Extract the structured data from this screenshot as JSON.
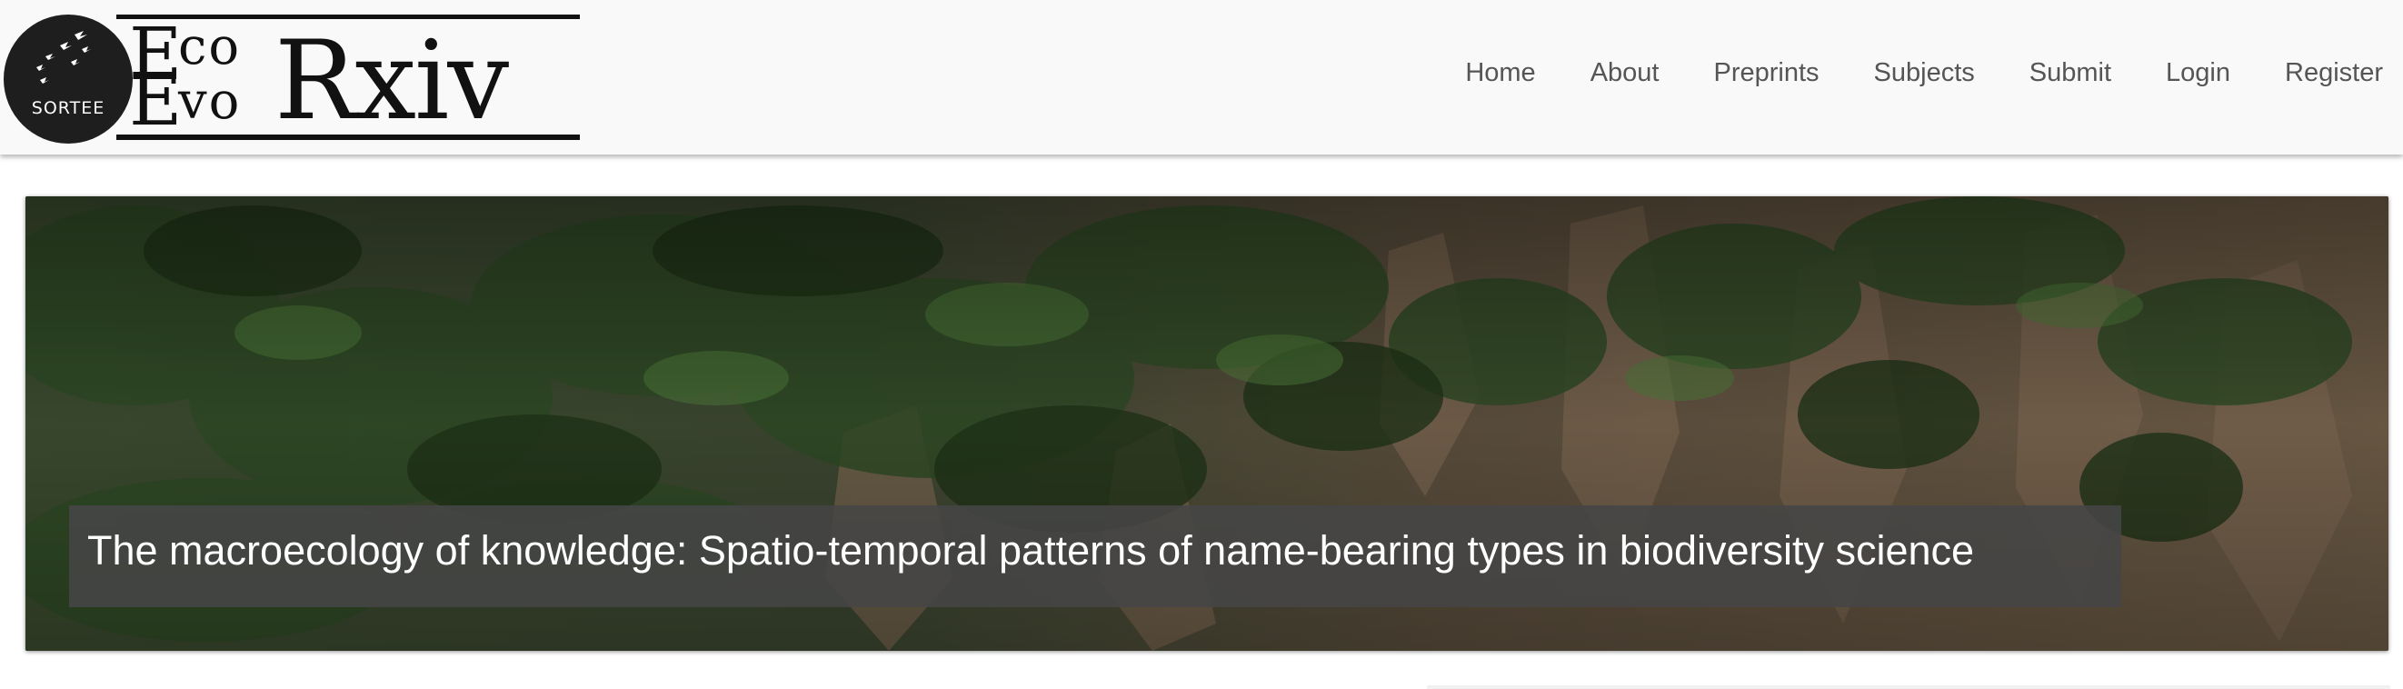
{
  "site": {
    "logo_badge": "SORTEE",
    "wordmark": {
      "e1": "E",
      "co": "co",
      "e2": "E",
      "vo": "vo",
      "rxiv": "Rxiv"
    }
  },
  "nav": {
    "items": [
      {
        "label": "Home"
      },
      {
        "label": "About"
      },
      {
        "label": "Preprints"
      },
      {
        "label": "Subjects"
      },
      {
        "label": "Submit"
      },
      {
        "label": "Login"
      },
      {
        "label": "Register"
      }
    ]
  },
  "hero": {
    "title": "The macroecology of knowledge: Spatio-temporal patterns of name-bearing types in biodiversity science"
  },
  "colors": {
    "topbar_bg": "#f9f9f9",
    "nav_text": "#555555",
    "caption_bg": "#464646"
  }
}
